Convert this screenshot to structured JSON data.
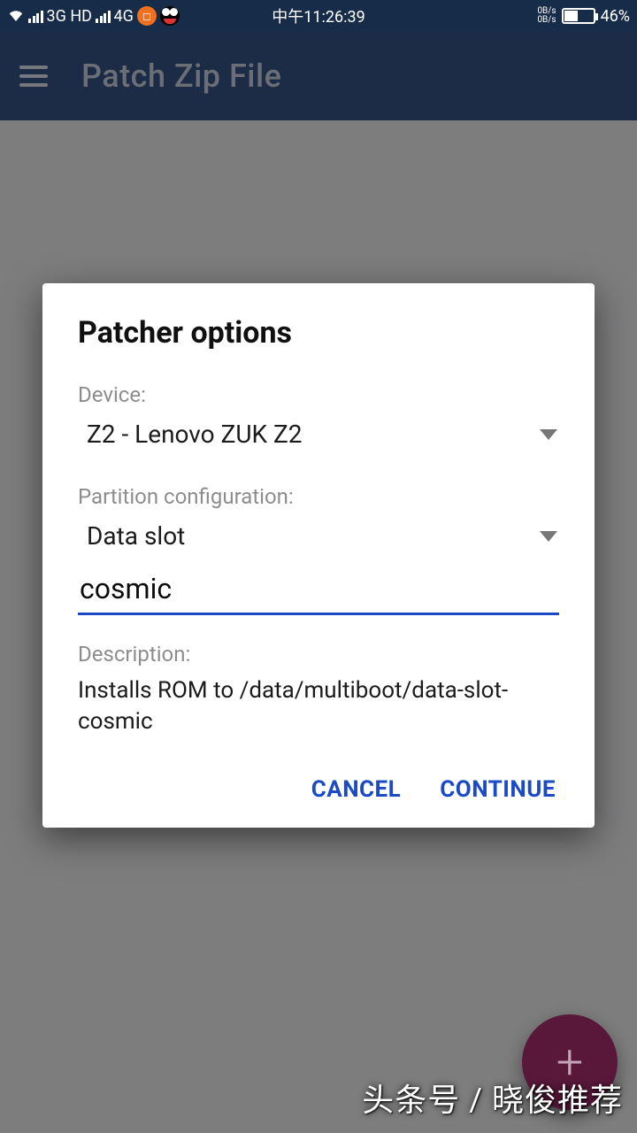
{
  "status": {
    "network1": "3G HD",
    "network2": "4G",
    "notif_square": "◻",
    "time": "中午11:26:39",
    "net_up": "0B/s",
    "net_down": "0B/s",
    "battery_pct": "46%"
  },
  "appbar": {
    "title": "Patch Zip File"
  },
  "dialog": {
    "title": "Patcher options",
    "device_label": "Device:",
    "device_value": "Z2 - Lenovo ZUK Z2",
    "partition_label": "Partition configuration:",
    "partition_value": "Data slot",
    "input_value": "cosmic",
    "description_label": "Description:",
    "description_text": "Installs ROM to /data/multiboot/data-slot-cosmic",
    "cancel": "CANCEL",
    "continue": "CONTINUE"
  },
  "fab": {
    "glyph": "+"
  },
  "watermark": "头条号 / 晓俊推荐"
}
